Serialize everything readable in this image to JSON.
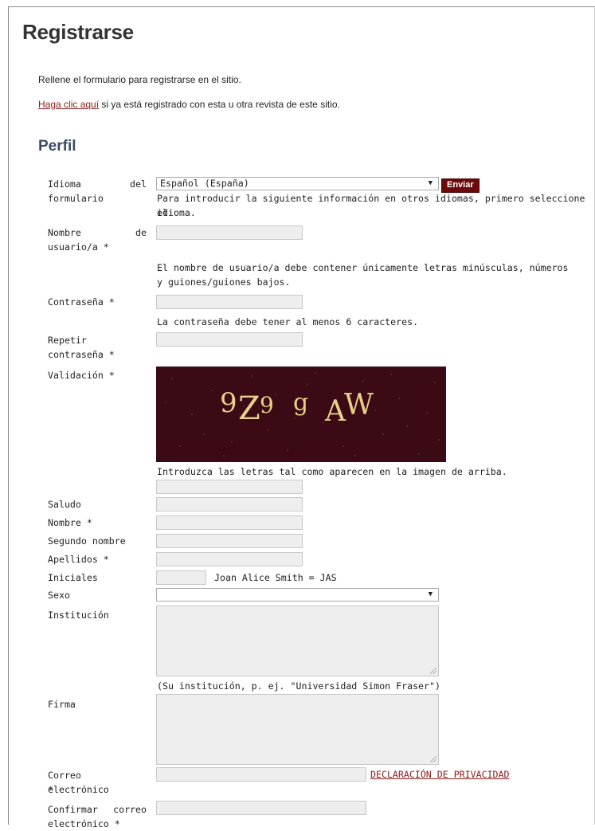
{
  "page_title": "Registrarse",
  "intro_text": "Rellene el formulario para registrarse en el sitio.",
  "login_link": "Haga clic aquí",
  "login_text": " si ya está registrado con esta u otra revista de este sitio.",
  "section_title": "Perfil",
  "language": {
    "label_1": "Idioma",
    "label_1b": "del",
    "label_2": "formulario",
    "selected": "Español (España)",
    "submit": "Enviar",
    "help_1": "Para introducir la siguiente información en otros idiomas, primero seleccione el",
    "help_2": "idioma."
  },
  "username": {
    "label_1": "Nombre",
    "label_1b": "de",
    "label_2": "usuario/a *",
    "help_1": "El nombre de usuario/a debe contener únicamente letras minúsculas, números",
    "help_2": "y guiones/guiones bajos."
  },
  "password": {
    "label": "Contraseña *",
    "help": "La contraseña debe tener al menos 6 caracteres."
  },
  "repeat_password": {
    "label_1": "Repetir",
    "label_2": "contraseña *"
  },
  "validation": {
    "label": "Validación *",
    "captcha_chars": [
      "9",
      "Z",
      "9",
      "g",
      "A",
      "W"
    ],
    "help": "Introduzca las letras tal como aparecen en la imagen de arriba."
  },
  "salutation": {
    "label": "Saludo"
  },
  "first_name": {
    "label": "Nombre *"
  },
  "middle_name": {
    "label": "Segundo nombre"
  },
  "last_name": {
    "label": "Apellidos *"
  },
  "initials": {
    "label": "Iniciales",
    "example": "Joan Alice Smith = JAS"
  },
  "gender": {
    "label": "Sexo"
  },
  "affiliation": {
    "label": "Institución",
    "help": "(Su institución, p. ej. \"Universidad Simon Fraser\")"
  },
  "signature": {
    "label": "Firma"
  },
  "email": {
    "label_1": "Correo electrónico",
    "label_2": "*",
    "privacy": "DECLARACIÓN DE PRIVACIDAD"
  },
  "confirm_email": {
    "label_1": "Confirmar",
    "label_1b": "correo",
    "label_2": "electrónico *"
  },
  "colors": {
    "accent": "#6b0a0a",
    "link": "#8b1a1a",
    "section_title": "#3d4a63",
    "field_bg": "#eeeeee"
  }
}
